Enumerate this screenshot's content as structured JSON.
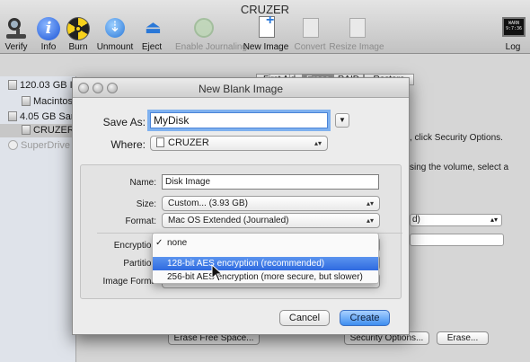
{
  "window": {
    "title": "CRUZER"
  },
  "toolbar": {
    "verify": "Verify",
    "info": "Info",
    "burn": "Burn",
    "unmount": "Unmount",
    "eject": "Eject",
    "enable_journaling": "Enable Journaling",
    "new_image": "New Image",
    "convert": "Convert",
    "resize_image": "Resize Image",
    "log": "Log",
    "log_screen": "WARN\n9:7:36"
  },
  "sidebar": {
    "items": [
      {
        "label": "120.03 GB I"
      },
      {
        "label": "Macintos"
      },
      {
        "label": "4.05 GB Sar"
      },
      {
        "label": "CRUZER"
      },
      {
        "label": "SuperDrive"
      }
    ]
  },
  "background": {
    "tabs": [
      "First Aid",
      "Erase",
      "RAID",
      "Restore"
    ],
    "text1": ", click Security Options.",
    "text2": "sing the volume, select a",
    "select1": "d)",
    "erase_free_space": "Erase Free Space...",
    "security_options": "Security Options...",
    "erase": "Erase..."
  },
  "dialog": {
    "title": "New Blank Image",
    "save_as_label": "Save As:",
    "save_as_value": "MyDisk",
    "where_label": "Where:",
    "where_value": "CRUZER",
    "name_label": "Name:",
    "name_value": "Disk Image",
    "size_label": "Size:",
    "size_value": "Custom... (3.93 GB)",
    "format_label": "Format:",
    "format_value": "Mac OS Extended (Journaled)",
    "encryption_label": "Encryption",
    "partitions_label": "Partition",
    "image_format_label": "Image Forma",
    "cancel": "Cancel",
    "create": "Create"
  },
  "encryption_menu": {
    "options": [
      {
        "label": "none",
        "checked": true
      },
      {
        "label": "128-bit AES encryption (recommended)",
        "highlighted": true
      },
      {
        "label": "256-bit AES encryption (more secure, but slower)"
      }
    ]
  },
  "colors": {
    "accent": "#3d8ef0",
    "highlight": "#2f6ae0"
  }
}
